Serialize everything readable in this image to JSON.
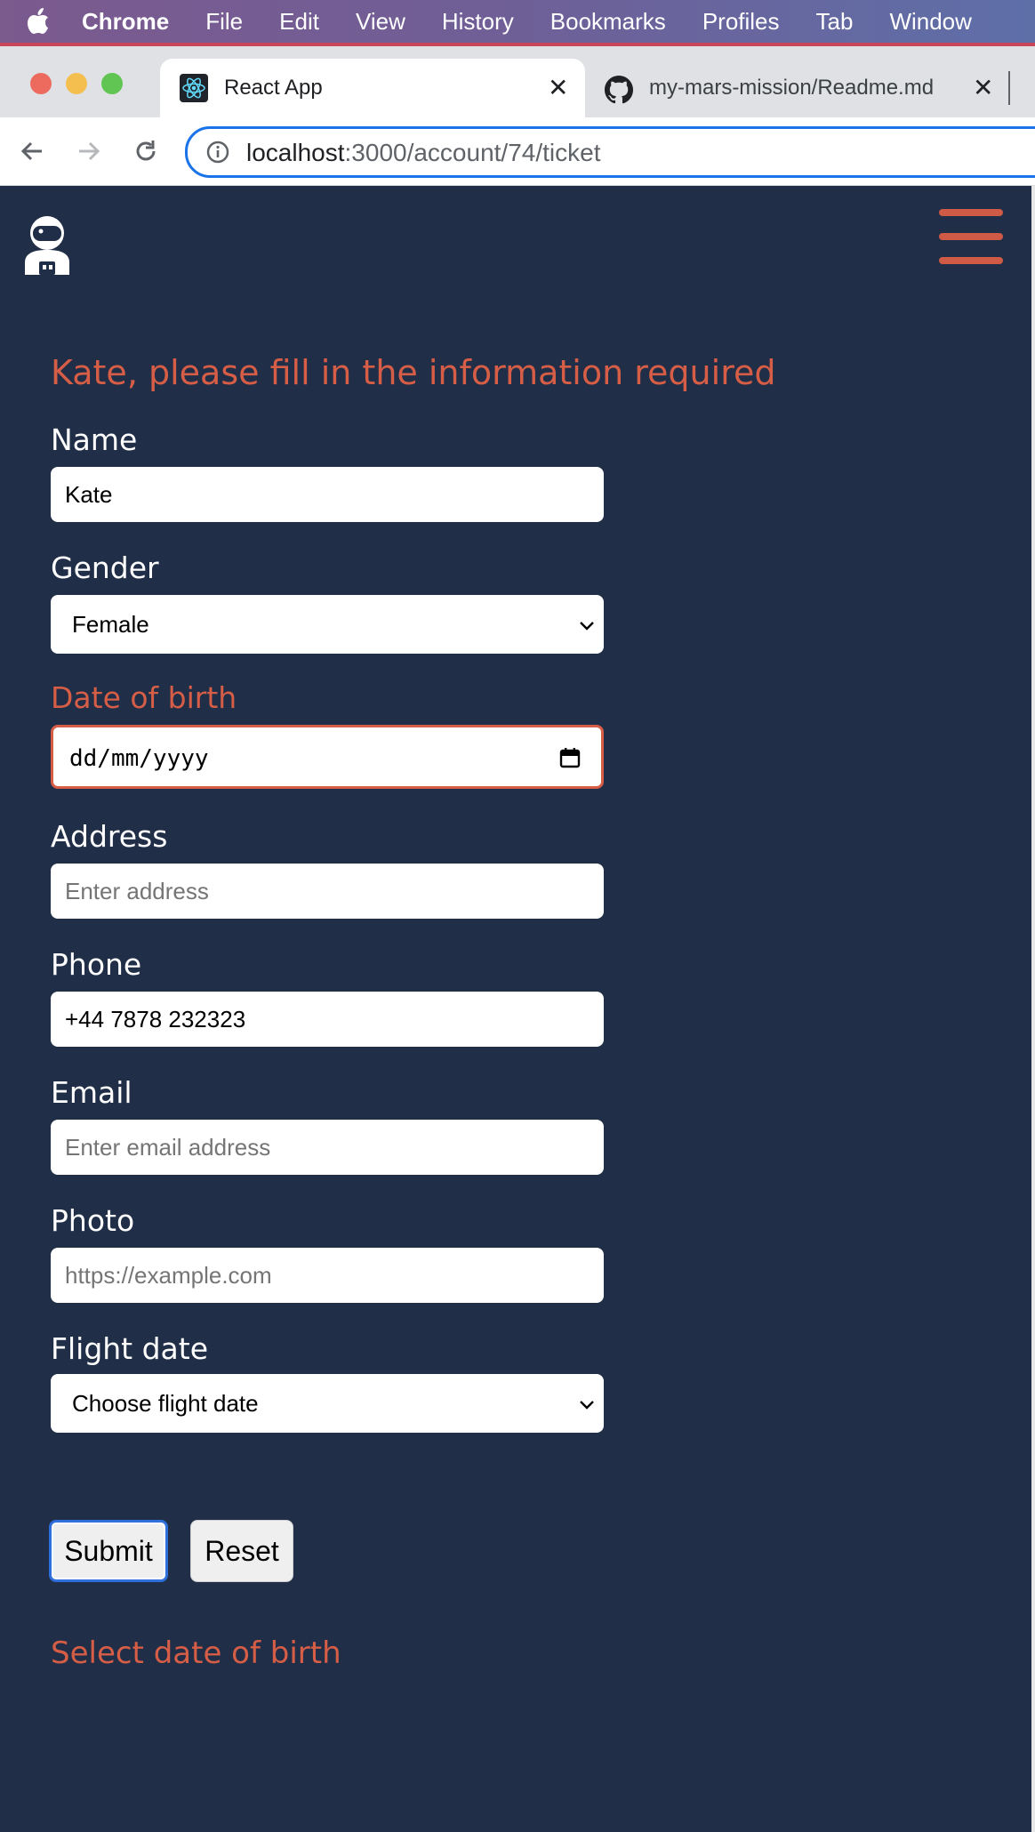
{
  "menubar": {
    "items": [
      "Chrome",
      "File",
      "Edit",
      "View",
      "History",
      "Bookmarks",
      "Profiles",
      "Tab",
      "Window"
    ]
  },
  "tabs": [
    {
      "title": "React App",
      "active": true
    },
    {
      "title": "my-mars-mission/Readme.md",
      "active": false
    }
  ],
  "address": {
    "host": "localhost",
    "path": ":3000/account/74/ticket"
  },
  "form": {
    "heading": "Kate, please fill in the information required",
    "name_label": "Name",
    "name_value": "Kate",
    "gender_label": "Gender",
    "gender_value": "Female",
    "dob_label": "Date of birth",
    "dob_placeholder": "dd/mm/yyyy",
    "address_label": "Address",
    "address_placeholder": "Enter address",
    "phone_label": "Phone",
    "phone_value": "+44 7878 232323",
    "email_label": "Email",
    "email_placeholder": "Enter email address",
    "photo_label": "Photo",
    "photo_placeholder": "https://example.com",
    "flight_label": "Flight date",
    "flight_value": "Choose flight date",
    "submit_label": "Submit",
    "reset_label": "Reset",
    "error_message": "Select date of birth"
  },
  "colors": {
    "page_bg": "#212e47",
    "accent": "#d65d46",
    "focus_ring": "#2f6fdb"
  },
  "icons": [
    "apple-icon",
    "react-icon",
    "github-icon",
    "back-icon",
    "forward-icon",
    "reload-icon",
    "info-icon",
    "astronaut-logo-icon",
    "hamburger-menu-icon",
    "calendar-icon",
    "chevron-down-icon"
  ]
}
